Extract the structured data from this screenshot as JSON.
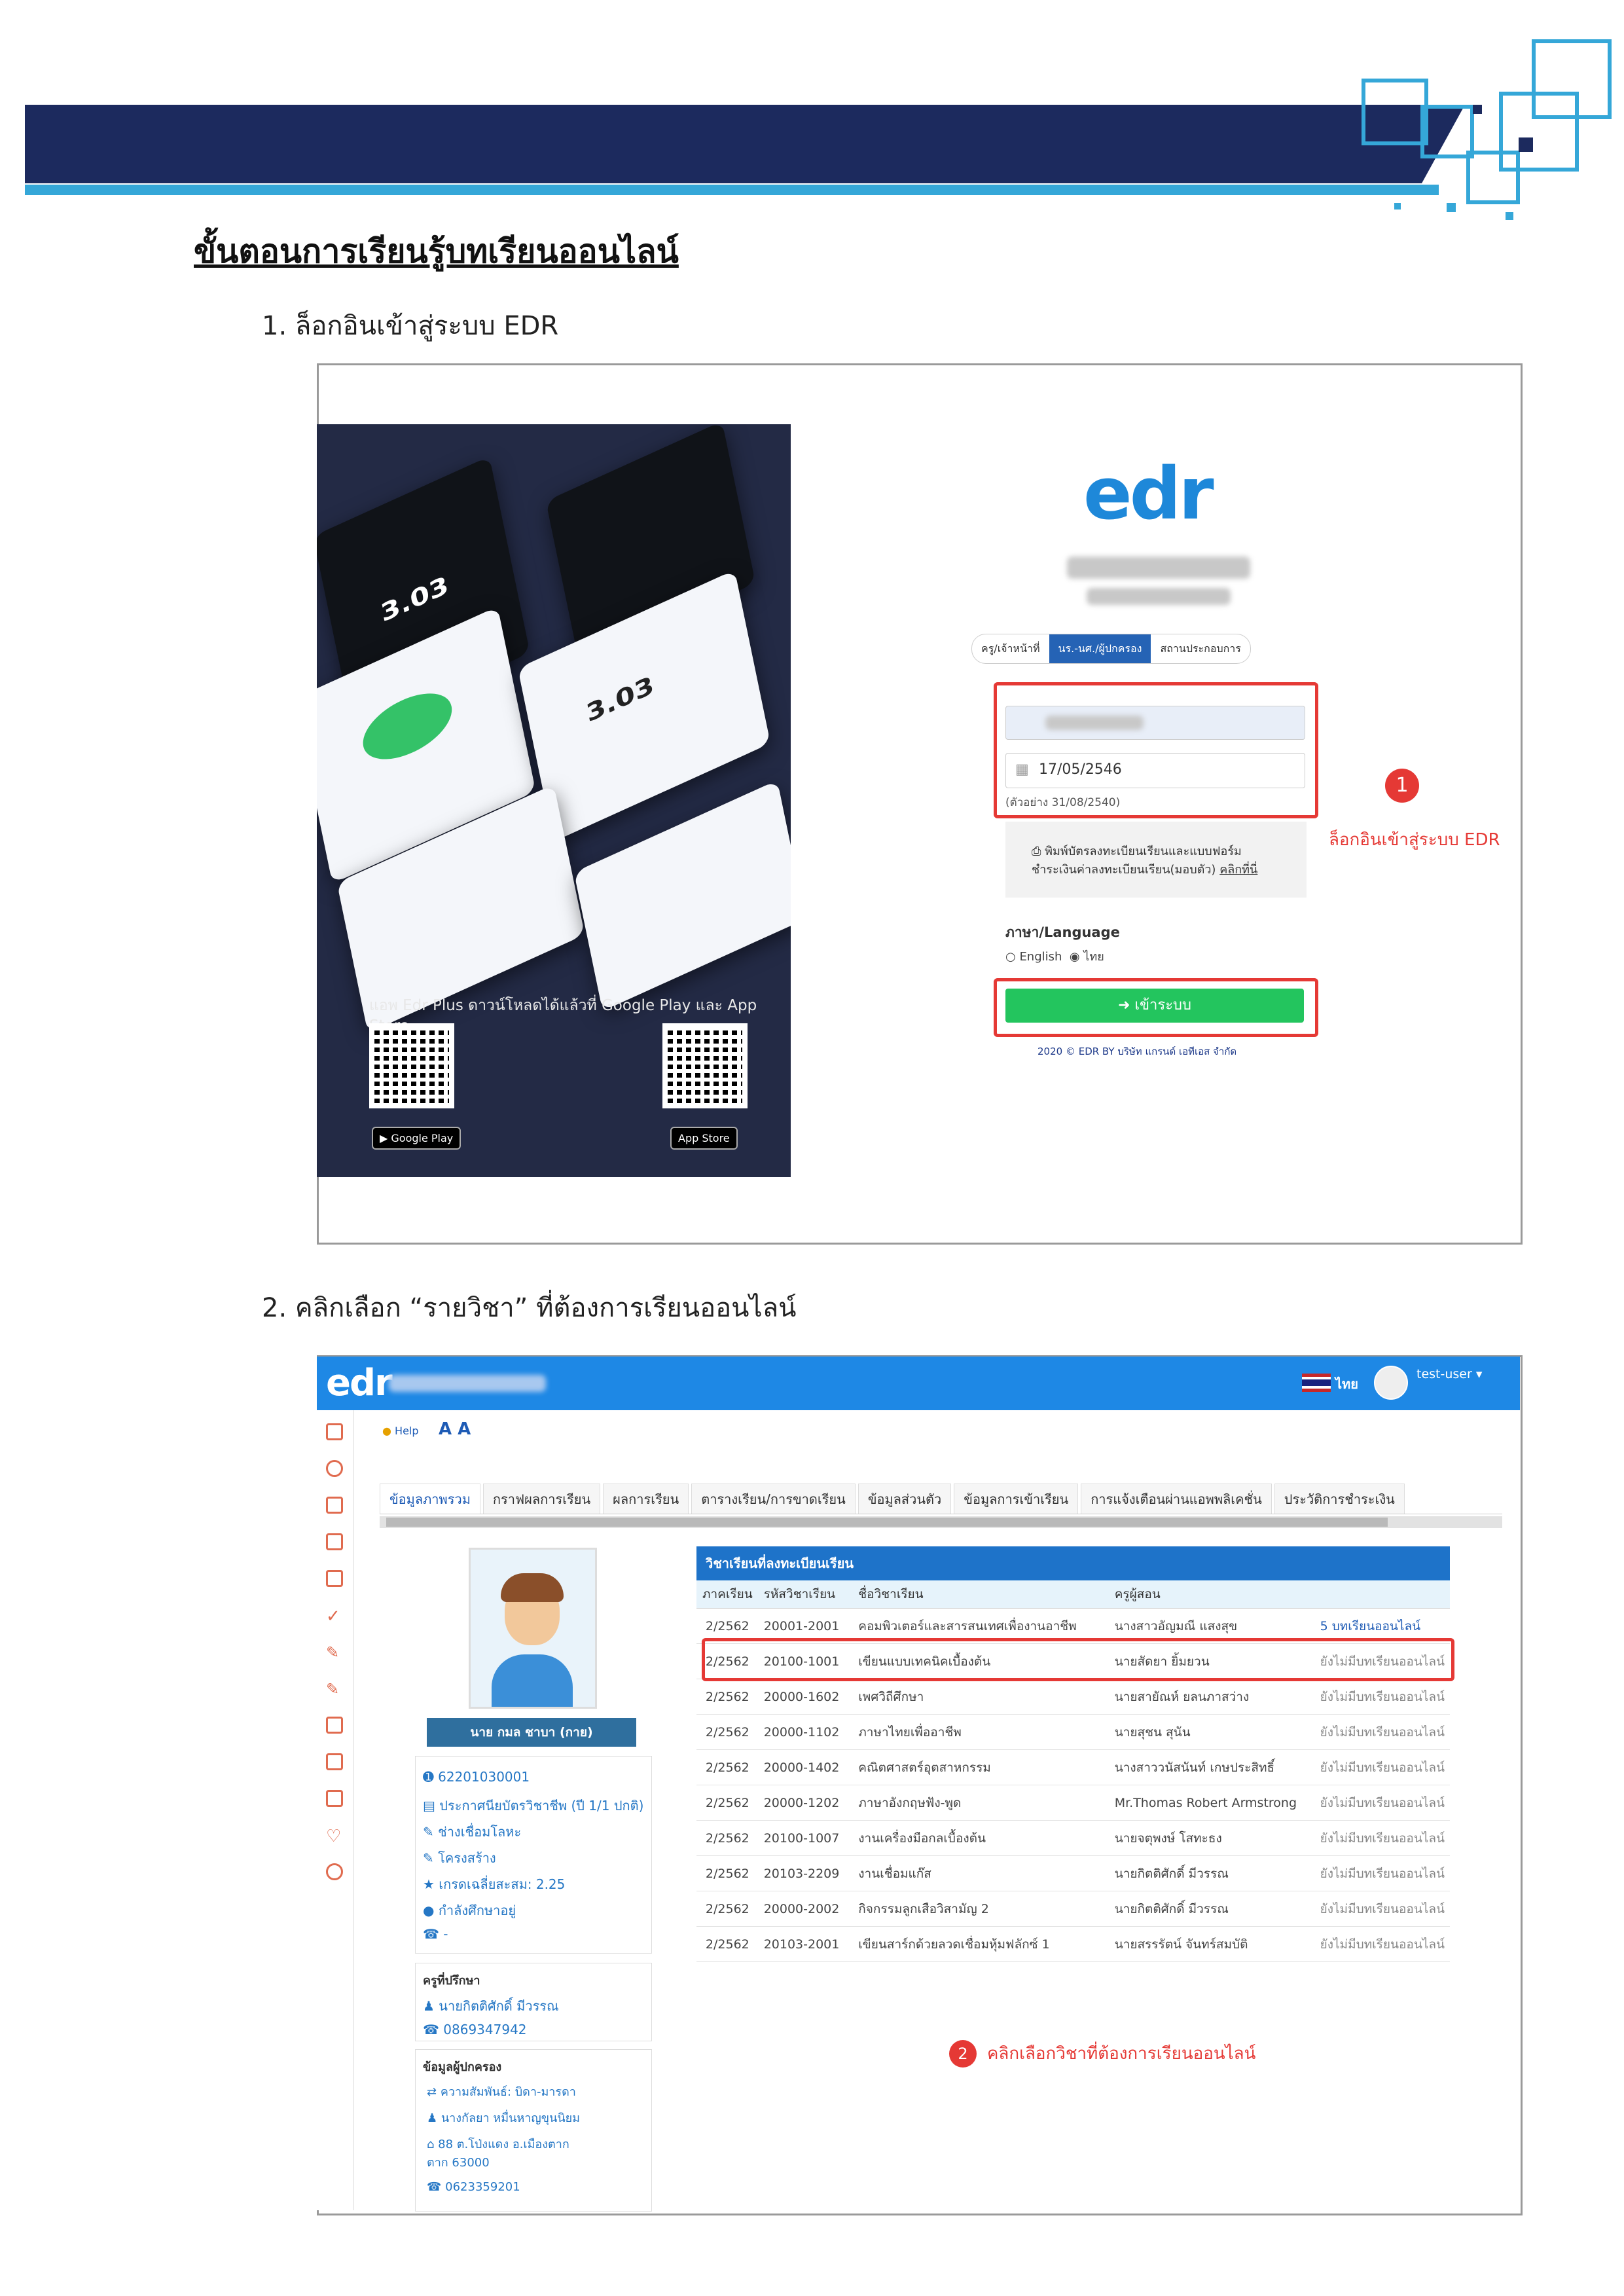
{
  "document": {
    "title": "ขั้นตอนการเรียนรู้บทเรียนออนไลน์",
    "step1": "1.  ล็อกอินเข้าสู่ระบบ EDR",
    "step2": "2.  คลิกเลือก “รายวิชา” ที่ต้องการเรียนออนไลน์"
  },
  "login": {
    "poster_caption": "แอพ Edr Plus ดาวน์โหลดได้แล้วที่ Google Play และ App Store",
    "google_play": "Google Play",
    "app_store": "App Store",
    "logo": "edr",
    "tabs": [
      "ครู/เจ้าหน้าที่",
      "นร.-นศ./ผู้ปกครอง",
      "สถานประกอบการ"
    ],
    "birthdate_value": "17/05/2546",
    "birthdate_hint": "(ตัวอย่าง 31/08/2540)",
    "print_link_line1": "พิมพ์บัตรลงทะเบียนเรียนและแบบฟอร์ม",
    "print_link_line2": "ชำระเงินค่าลงทะเบียนเรียน(มอบตัว)",
    "print_link_click": "คลิกที่นี่",
    "language_label": "ภาษา/Language",
    "lang_english": "English",
    "lang_thai": "ไทย",
    "login_button": "เข้าระบบ",
    "footer": "2020 © EDR BY บริษัท แกรนด์ เอทีเอส จำกัด",
    "annotation_number": "1",
    "annotation_text": "ล็อกอินเข้าสู่ระบบ EDR"
  },
  "app": {
    "logo": "edr",
    "language": "ไทย",
    "user": "test-user",
    "help": "Help",
    "font_size": "A A",
    "tabs": [
      "ข้อมูลภาพรวม",
      "กราฟผลการเรียน",
      "ผลการเรียน",
      "ตารางเรียน/การขาดเรียน",
      "ข้อมูลส่วนตัว",
      "ข้อมูลการเข้าเรียน",
      "การแจ้งเตือนผ่านแอพพลิเคชั่น",
      "ประวัติการชำระเงิน"
    ],
    "student_name": "นาย กมล ชาบา (กาย)",
    "student_info": [
      "62201030001",
      "ประกาศนียบัตรวิชาชีพ (ปี 1/1 ปกติ)",
      "ช่างเชื่อมโลหะ",
      "โครงสร้าง",
      "เกรดเฉลี่ยสะสม: 2.25",
      "กำลังศึกษาอยู่",
      "-"
    ],
    "advisor_label": "ครูที่ปรึกษา",
    "advisor_name": "นายกิตติศักดิ์ มีวรรณ",
    "advisor_phone": "0869347942",
    "guardian_label": "ข้อมูลผู้ปกครอง",
    "guardian_relation": "ความสัมพันธ์: บิดา-มารดา",
    "guardian_name": "นางกัลยา หมื่นหาญขุนนิยม",
    "guardian_address1": "88 ต.โป่งแดง อ.เมืองตาก",
    "guardian_address2": "ตาก 63000",
    "guardian_phone": "0623359201",
    "table_title": "วิชาเรียนที่ลงทะเบียนเรียน",
    "columns": [
      "ภาคเรียน",
      "รหัสวิชาเรียน",
      "ชื่อวิชาเรียน",
      "ครูผู้สอน",
      ""
    ],
    "rows": [
      [
        "2/2562",
        "20001-2001",
        "คอมพิวเตอร์และสารสนเทศเพื่องานอาชีพ",
        "นางสาวอัญมณี แสงสุข",
        "5 บทเรียนออนไลน์"
      ],
      [
        "2/2562",
        "20100-1001",
        "เขียนแบบเทคนิคเบื้องต้น",
        "นายสัดยา ยิ้มยวน",
        "ยังไม่มีบทเรียนออนไลน์"
      ],
      [
        "2/2562",
        "20000-1602",
        "เพศวิถีศึกษา",
        "นายสายัณห์ ยลนภาสว่าง",
        "ยังไม่มีบทเรียนออนไลน์"
      ],
      [
        "2/2562",
        "20000-1102",
        "ภาษาไทยเพื่ออาชีพ",
        "นายสุชน สุนัน",
        "ยังไม่มีบทเรียนออนไลน์"
      ],
      [
        "2/2562",
        "20000-1402",
        "คณิตศาสตร์อุตสาหกรรม",
        "นางสาววนัสนันท์ เกษประสิทธิ์",
        "ยังไม่มีบทเรียนออนไลน์"
      ],
      [
        "2/2562",
        "20000-1202",
        "ภาษาอังกฤษฟัง-พูด",
        "Mr.Thomas Robert Armstrong",
        "ยังไม่มีบทเรียนออนไลน์"
      ],
      [
        "2/2562",
        "20100-1007",
        "งานเครื่องมือกลเบื้องต้น",
        "นายจตุพงษ์ โสทะธง",
        "ยังไม่มีบทเรียนออนไลน์"
      ],
      [
        "2/2562",
        "20103-2209",
        "งานเชื่อมแก๊ส",
        "นายกิตติศักดิ์ มีวรรณ",
        "ยังไม่มีบทเรียนออนไลน์"
      ],
      [
        "2/2562",
        "20000-2002",
        "กิจกรรมลูกเสือวิสามัญ 2",
        "นายกิตติศักดิ์ มีวรรณ",
        "ยังไม่มีบทเรียนออนไลน์"
      ],
      [
        "2/2562",
        "20103-2001",
        "เขียนสาร์กด้วยลวดเชื่อมหุ้มฟลักซ์ 1",
        "นายสรรรัตน์ จันทร์สมบัติ",
        "ยังไม่มีบทเรียนออนไลน์"
      ]
    ],
    "annotation_number": "2",
    "annotation_text": "คลิกเลือกวิชาที่ต้องการเรียนออนไลน์"
  }
}
